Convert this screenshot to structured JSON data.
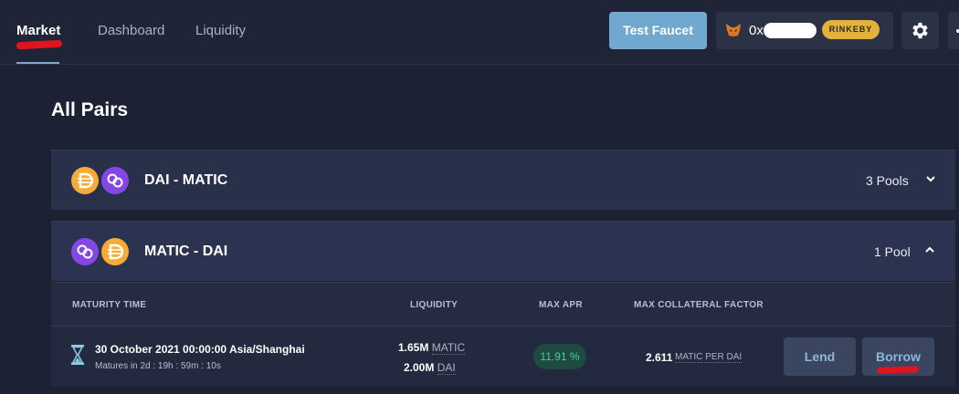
{
  "nav": {
    "tabs": [
      {
        "label": "Market",
        "active": true
      },
      {
        "label": "Dashboard",
        "active": false
      },
      {
        "label": "Liquidity",
        "active": false
      }
    ]
  },
  "header": {
    "faucet_label": "Test Faucet",
    "wallet": {
      "address_prefix": "0x",
      "network": "RINKEBY",
      "icon": "metamask-fox-icon"
    },
    "settings_icon": "gear-icon"
  },
  "page": {
    "title": "All Pairs"
  },
  "pairs": [
    {
      "name": "DAI - MATIC",
      "pools": "3 Pools",
      "expanded": false
    },
    {
      "name": "MATIC - DAI",
      "pools": "1 Pool",
      "expanded": true
    }
  ],
  "table": {
    "headers": {
      "maturity": "MATURITY TIME",
      "liquidity": "LIQUIDITY",
      "apr": "MAX APR",
      "collateral": "MAX COLLATERAL FACTOR"
    },
    "rows": [
      {
        "maturity": "30 October 2021 00:00:00 Asia/Shanghai",
        "matures_in": "Matures in 2d : 19h : 59m : 10s",
        "liquidity_1_value": "1.65M",
        "liquidity_1_unit": "MATIC",
        "liquidity_2_value": "2.00M",
        "liquidity_2_unit": "DAI",
        "apr": "11.91 %",
        "cf_value": "2.611",
        "cf_unit": "MATIC PER DAI",
        "lend_label": "Lend",
        "borrow_label": "Borrow"
      }
    ]
  },
  "colors": {
    "background": "#1c2233",
    "accent": "#71a8cf",
    "dai": "#f5ac37",
    "matic": "#8247e5",
    "apr_green": "#3fd1a3",
    "network_badge": "#e3b23c",
    "annotation_red": "#e0141e"
  }
}
